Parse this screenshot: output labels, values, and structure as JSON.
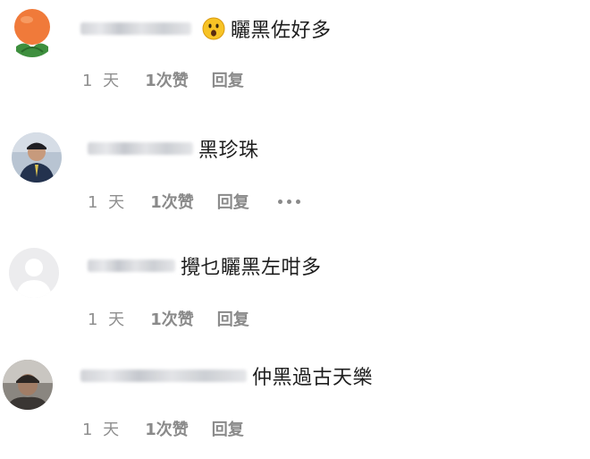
{
  "comments": [
    {
      "text": "矖黑佐好多",
      "time": "1 天",
      "likes": "1次赞",
      "reply": "回复",
      "emoji": "astonished-face",
      "show_more": false
    },
    {
      "text": "黑珍珠",
      "time": "1 天",
      "likes": "1次赞",
      "reply": "回复",
      "show_more": true
    },
    {
      "text": "攪乜矖黑左咁多",
      "time": "1 天",
      "likes": "1次赞",
      "reply": "回复",
      "show_more": false
    },
    {
      "text": "仲黑過古天樂",
      "time": "1 天",
      "likes": "1次赞",
      "reply": "回复",
      "show_more": false
    }
  ],
  "colors": {
    "text": "#1e1e1e",
    "meta": "#8a8a8a",
    "background": "#ffffff"
  }
}
